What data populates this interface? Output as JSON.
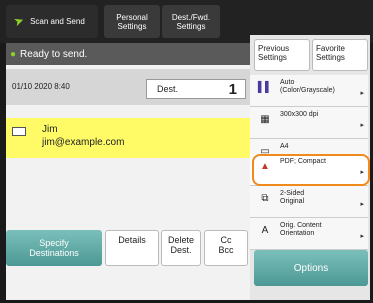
{
  "tabs": {
    "scan_send": "Scan and Send",
    "personal_settings_1": "Personal",
    "personal_settings_2": "Settings",
    "dest_settings_1": "Dest./Fwd.",
    "dest_settings_2": "Settings"
  },
  "status": {
    "text": "Ready to send."
  },
  "header": {
    "date": "01/10 2020 8:40",
    "dest_label": "Dest.",
    "dest_count": "1"
  },
  "destination": {
    "name": "Jim",
    "email": "jim@example.com"
  },
  "buttons": {
    "specify_1": "Specify",
    "specify_2": "Destinations",
    "details": "Details",
    "delete_1": "Delete",
    "delete_2": "Dest.",
    "cc_1": "Cc",
    "cc_2": "Bcc"
  },
  "right_top": {
    "previous_1": "Previous",
    "previous_2": "Settings",
    "favorite_1": "Favorite",
    "favorite_2": "Settings"
  },
  "options": [
    {
      "line1": "Auto",
      "line2": "(Color/Grayscale)"
    },
    {
      "line1": "300x300 dpi",
      "line2": ""
    },
    {
      "line1": "A4",
      "line2": ""
    },
    {
      "line1": "PDF; Compact",
      "line2": ""
    },
    {
      "line1": "2-Sided",
      "line2": "Original"
    },
    {
      "line1": "Orig. Content",
      "line2": "Orientation"
    }
  ],
  "options_button": "Options",
  "colors": {
    "accent_green": "#8ad12a",
    "teal": "#5aa5a1",
    "highlight_orange": "#f08a1c",
    "selected_yellow": "#fffb66"
  }
}
